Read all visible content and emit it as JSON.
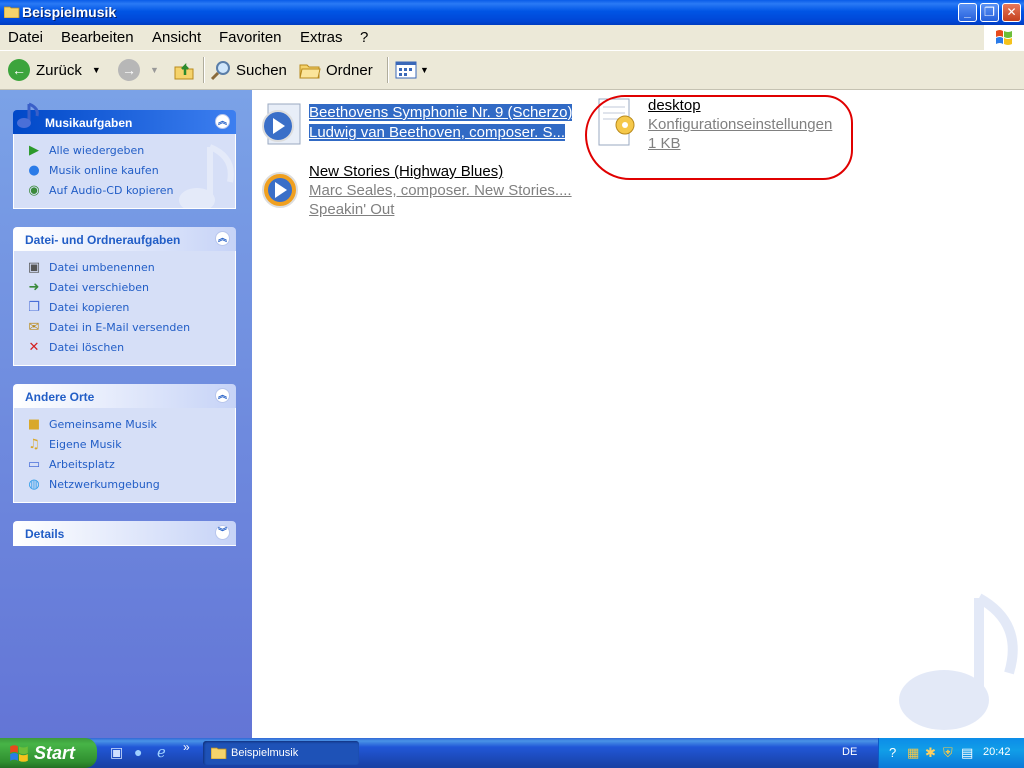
{
  "window": {
    "title": "Beispielmusik"
  },
  "menu": [
    "Datei",
    "Bearbeiten",
    "Ansicht",
    "Favoriten",
    "Extras",
    "?"
  ],
  "toolbar": {
    "back": "Zurück",
    "search": "Suchen",
    "folders": "Ordner"
  },
  "panels": [
    {
      "title": "Musikaufgaben",
      "tasks": [
        "Alle wiedergeben",
        "Musik online kaufen",
        "Auf Audio-CD kopieren"
      ]
    },
    {
      "title": "Datei- und Ordneraufgaben",
      "tasks": [
        "Datei umbenennen",
        "Datei verschieben",
        "Datei kopieren",
        "Datei in E-Mail versenden",
        "Datei löschen"
      ]
    },
    {
      "title": "Andere Orte",
      "tasks": [
        "Gemeinsame Musik",
        "Eigene Musik",
        "Arbeitsplatz",
        "Netzwerkumgebung"
      ]
    },
    {
      "title": "Details",
      "tasks": []
    }
  ],
  "files": [
    {
      "name": "Beethovens Symphonie Nr. 9 (Scherzo)",
      "line1": "Ludwig van Beethoven, composer. S...",
      "line2": ""
    },
    {
      "name": "New Stories (Highway Blues)",
      "line1": "Marc Seales, composer. New Stories....",
      "line2": "Speakin' Out"
    },
    {
      "name": "desktop",
      "line1": "Konfigurationseinstellungen",
      "line2": "1 KB"
    }
  ],
  "taskbar": {
    "start": "Start",
    "window": "Beispielmusik",
    "lang": "DE",
    "clock": "20:42"
  },
  "colors": {
    "titlebar": "#0055e5",
    "taskpane": "#6375d6",
    "link": "#215dc6",
    "annotation": "#e00000"
  }
}
